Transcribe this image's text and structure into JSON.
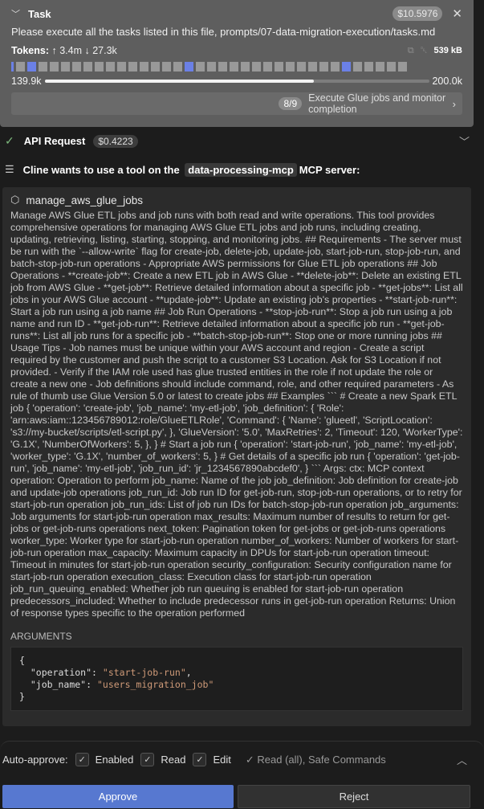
{
  "task": {
    "title": "Task",
    "cost": "$10.5976",
    "text": "Please execute all the tasks listed in this file, prompts/07-data-migration-execution/tasks.md",
    "tokens_label": "Tokens:",
    "tokens_up": "↑ 3.4m",
    "tokens_down": "↓ 27.3k",
    "size": "539 kB",
    "segments_count": 35,
    "blue_segments": [
      1,
      15,
      29
    ],
    "context_used": "139.9k",
    "context_max": "200.0k",
    "context_fraction": 0.7,
    "subtask": {
      "count": "8/9",
      "label": "Execute Glue jobs and monitor completion",
      "progress": 0.78
    }
  },
  "api": {
    "title": "API Request",
    "cost": "$0.4223"
  },
  "mcp": {
    "prefix": "Cline wants to use a tool on the",
    "server": "data-processing-mcp",
    "suffix": "MCP server:"
  },
  "tool": {
    "name": "manage_aws_glue_jobs",
    "description": "Manage AWS Glue ETL jobs and job runs with both read and write operations. This tool provides comprehensive operations for managing AWS Glue ETL jobs and job runs, including creating, updating, retrieving, listing, starting, stopping, and monitoring jobs. ## Requirements - The server must be run with the `--allow-write` flag for create-job, delete-job, update-job, start-job-run, stop-job-run, and batch-stop-job-run operations - Appropriate AWS permissions for Glue ETL job operations ## Job Operations - **create-job**: Create a new ETL job in AWS Glue - **delete-job**: Delete an existing ETL job from AWS Glue - **get-job**: Retrieve detailed information about a specific job - **get-jobs**: List all jobs in your AWS Glue account - **update-job**: Update an existing job's properties - **start-job-run**: Start a job run using a job name ## Job Run Operations - **stop-job-run**: Stop a job run using a job name and run ID - **get-job-run**: Retrieve detailed information about a specific job run - **get-job-runs**: List all job runs for a specific job - **batch-stop-job-run**: Stop one or more running jobs ## Usage Tips - Job names must be unique within your AWS account and region - Create a script required by the customer and push the script to a customer S3 Location. Ask for S3 Location if not provided. - Verify if the IAM role used has glue trusted entities in the role if not update the role or create a new one - Job definitions should include command, role, and other required parameters - As rule of thumb use Glue Version 5.0 or latest to create jobs ## Examples ``` # Create a new Spark ETL job { 'operation': 'create-job', 'job_name': 'my-etl-job', 'job_definition': { 'Role': 'arn:aws:iam::123456789012:role/GlueETLRole', 'Command': { 'Name': 'glueetl', 'ScriptLocation': 's3://my-bucket/scripts/etl-script.py', }, 'GlueVersion': '5.0', 'MaxRetries': 2, 'Timeout': 120, 'WorkerType': 'G.1X', 'NumberOfWorkers': 5, }, } # Start a job run { 'operation': 'start-job-run', 'job_name': 'my-etl-job', 'worker_type': 'G.1X', 'number_of_workers': 5, } # Get details of a specific job run { 'operation': 'get-job-run', 'job_name': 'my-etl-job', 'job_run_id': 'jr_1234567890abcdef0', } ``` Args: ctx: MCP context operation: Operation to perform job_name: Name of the job job_definition: Job definition for create-job and update-job operations job_run_id: Job run ID for get-job-run, stop-job-run operations, or to retry for start-job-run operation job_run_ids: List of job run IDs for batch-stop-job-run operation job_arguments: Job arguments for start-job-run operation max_results: Maximum number of results to return for get-jobs or get-job-runs operations next_token: Pagination token for get-jobs or get-job-runs operations worker_type: Worker type for start-job-run operation number_of_workers: Number of workers for start-job-run operation max_capacity: Maximum capacity in DPUs for start-job-run operation timeout: Timeout in minutes for start-job-run operation security_configuration: Security configuration name for start-job-run operation execution_class: Execution class for start-job-run operation job_run_queuing_enabled: Whether job run queuing is enabled for start-job-run operation predecessors_included: Whether to include predecessor runs in get-job-run operation Returns: Union of response types specific to the operation performed",
    "arguments_label": "ARGUMENTS",
    "args": {
      "open": "{",
      "k1": "\"operation\"",
      "v1": "\"start-job-run\"",
      "k2": "\"job_name\"",
      "v2": "\"users_migration_job\"",
      "close": "}"
    }
  },
  "auto_approve": {
    "label": "Auto-approve:",
    "options": [
      {
        "label": "Enabled",
        "checked": true
      },
      {
        "label": "Read",
        "checked": true
      },
      {
        "label": "Edit",
        "checked": true
      }
    ],
    "summary": "✓ Read (all), Safe Commands"
  },
  "buttons": {
    "approve": "Approve",
    "reject": "Reject"
  }
}
